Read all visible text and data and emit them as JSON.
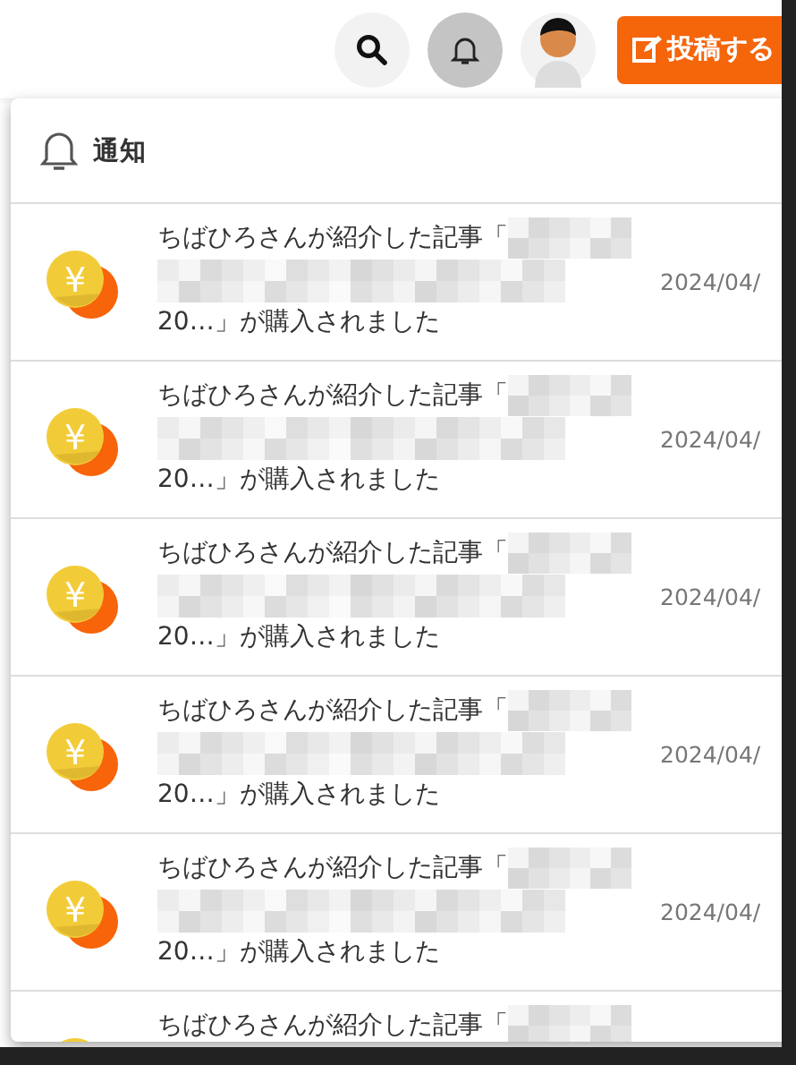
{
  "header": {
    "post_button": "投稿する",
    "bell_active": true
  },
  "panel": {
    "title": "通知"
  },
  "notifications": [
    {
      "icon_text": "¥",
      "text": "ちばひろさんが紹介した記事「",
      "end": "20…」が購入されました",
      "date": "2024/04/"
    },
    {
      "icon_text": "¥",
      "text": "ちばひろさんが紹介した記事「",
      "end": "20…」が購入されました",
      "date": "2024/04/"
    },
    {
      "icon_text": "¥",
      "text": "ちばひろさんが紹介した記事「",
      "end": "20…」が購入されました",
      "date": "2024/04/"
    },
    {
      "icon_text": "¥",
      "text": "ちばひろさんが紹介した記事「",
      "end": "20…」が購入されました",
      "date": "2024/04/"
    },
    {
      "icon_text": "¥",
      "text": "ちばひろさんが紹介した記事「",
      "end": "20…」が購入されました",
      "date": "2024/04/"
    },
    {
      "text": "ちばひろさんが紹介した記事「"
    }
  ]
}
